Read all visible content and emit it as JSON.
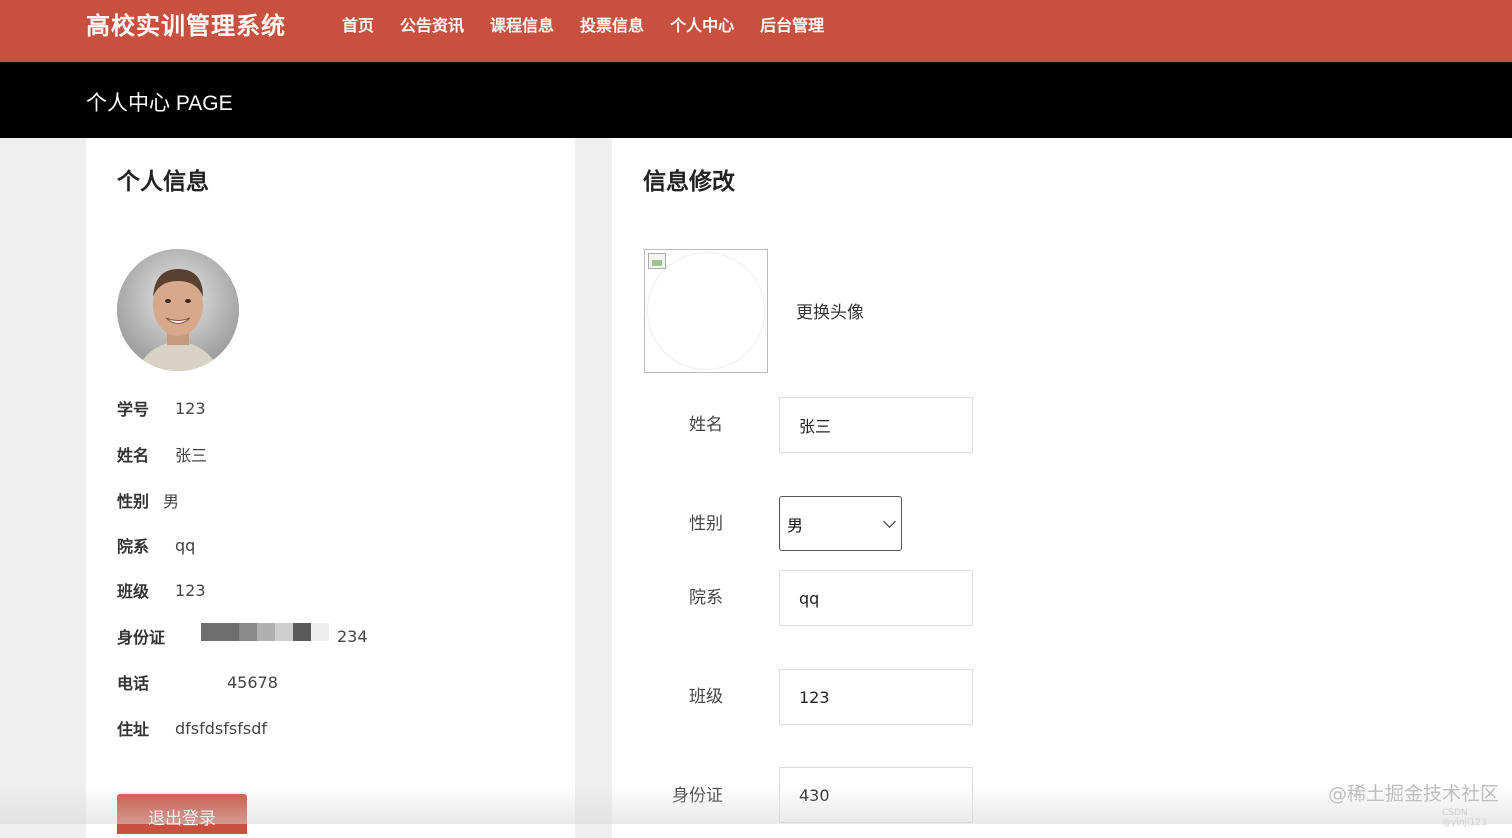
{
  "header": {
    "logo": "高校实训管理系统",
    "nav": [
      "首页",
      "公告资讯",
      "课程信息",
      "投票信息",
      "个人中心",
      "后台管理"
    ]
  },
  "banner": {
    "title": "个人中心 PAGE"
  },
  "profile": {
    "title": "个人信息",
    "rows": [
      {
        "label": "学号",
        "value": "123"
      },
      {
        "label": "姓名",
        "value": "张三"
      },
      {
        "label": "性别",
        "value": "男"
      },
      {
        "label": "院系",
        "value": "qq"
      },
      {
        "label": "班级",
        "value": "123"
      },
      {
        "label": "身份证",
        "value": "234"
      },
      {
        "label": "电话",
        "value": "45678"
      },
      {
        "label": "住址",
        "value": "dfsfdsfsfsdf"
      }
    ],
    "logout_label": "退出登录"
  },
  "edit": {
    "title": "信息修改",
    "change_avatar": "更换头像",
    "name_label": "姓名",
    "name_value": "张三",
    "gender_label": "性别",
    "gender_value": "男",
    "dept_label": "院系",
    "dept_value": "qq",
    "class_label": "班级",
    "class_value": "123",
    "id_label": "身份证",
    "id_value": "430"
  },
  "watermark": "@稀土掘金技术社区",
  "watermark_small": "CSDN @yinji123",
  "colors": {
    "brand": "#c9503f",
    "banner": "#000000"
  }
}
